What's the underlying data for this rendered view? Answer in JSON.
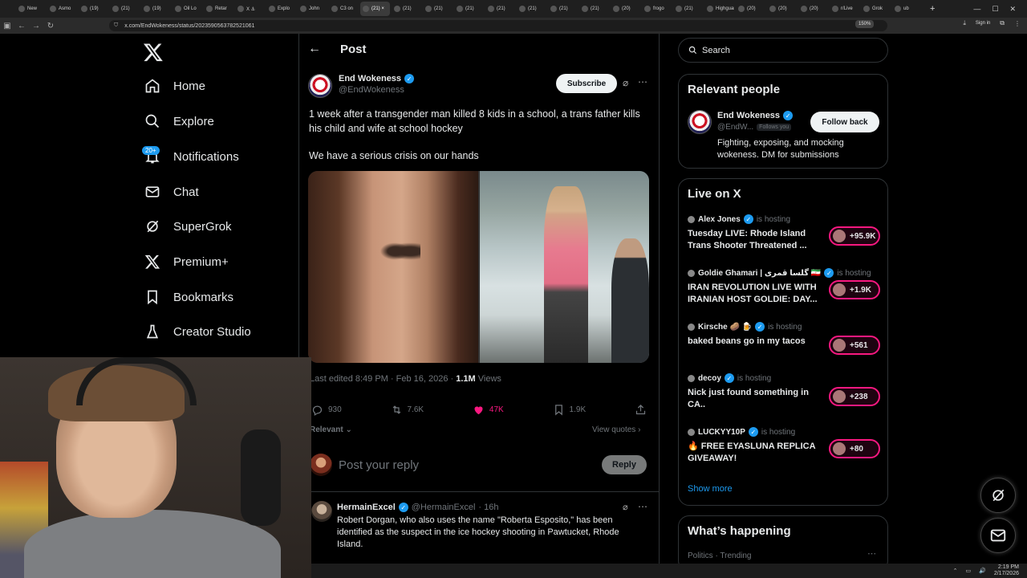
{
  "browser": {
    "tabs": [
      {
        "label": "New"
      },
      {
        "label": "Asmo"
      },
      {
        "label": "(19)"
      },
      {
        "label": "(21)"
      },
      {
        "label": "(19)"
      },
      {
        "label": "Oil Lo"
      },
      {
        "label": "Retar"
      },
      {
        "label": "X ⚓"
      },
      {
        "label": "Explo"
      },
      {
        "label": "John"
      },
      {
        "label": "C3 on"
      },
      {
        "label": "(21) ×",
        "active": true
      },
      {
        "label": "(21)"
      },
      {
        "label": "(21)"
      },
      {
        "label": "(21)"
      },
      {
        "label": "(21)"
      },
      {
        "label": "(21)"
      },
      {
        "label": "(21)"
      },
      {
        "label": "(21)"
      },
      {
        "label": "(20)"
      },
      {
        "label": "frogo"
      },
      {
        "label": "(21)"
      },
      {
        "label": "Highguar"
      },
      {
        "label": "(20)"
      },
      {
        "label": "(20)"
      },
      {
        "label": "(20)"
      },
      {
        "label": "r/Live"
      },
      {
        "label": "Grok"
      },
      {
        "label": "ub"
      }
    ],
    "url": "x.com/EndWokeness/status/2023590563782521061",
    "zoom": "150%",
    "signin": "Sign in"
  },
  "nav": {
    "items": [
      {
        "label": "Home"
      },
      {
        "label": "Explore"
      },
      {
        "label": "Notifications"
      },
      {
        "label": "Chat"
      },
      {
        "label": "SuperGrok"
      },
      {
        "label": "Premium+"
      },
      {
        "label": "Bookmarks"
      },
      {
        "label": "Creator Studio"
      }
    ],
    "notif_badge": "20+"
  },
  "post": {
    "header_title": "Post",
    "author_name": "End Wokeness",
    "author_handle": "@EndWokeness",
    "subscribe_label": "Subscribe",
    "text_line1": "1 week after a transgender man killed 8 kids in a school, a trans father kills his child and wife at school hockey",
    "text_line2": "We have a serious crisis on our hands",
    "edited_prefix": "Last edited 8:49 PM · Feb 16, 2026 · ",
    "views_count": "1.1M",
    "views_label": " Views",
    "stats": {
      "replies": "930",
      "reposts": "7.6K",
      "likes": "47K",
      "bookmarks": "1.9K"
    },
    "relevant_label": "Relevant ⌄",
    "view_quotes_label": "View quotes ›",
    "reply_placeholder": "Post your reply",
    "reply_button": "Reply"
  },
  "comment": {
    "name": "HermainExcel",
    "handle": "@HermainExcel",
    "time": "· 16h",
    "text": "Robert Dorgan, who also uses the name \"Roberta Esposito,\" has been identified as the suspect in the ice hockey shooting in Pawtucket, Rhode Island."
  },
  "sidebar": {
    "search_placeholder": "Search",
    "relevant": {
      "title": "Relevant people",
      "name": "End Wokeness",
      "handle": "@EndW...",
      "follows_you": "Follows you",
      "follow_back": "Follow back",
      "bio": "Fighting, exposing, and mocking wokeness. DM for submissions"
    },
    "live": {
      "title": "Live on X",
      "items": [
        {
          "host": "Alex Jones",
          "status": "is hosting",
          "title": "Tuesday LIVE: Rhode Island Trans Shooter Threatened ...",
          "count": "+95.9K"
        },
        {
          "host": "Goldie Ghamari | گلسا قمری 🇮🇷",
          "status": "is hosting",
          "title": "IRAN REVOLUTION LIVE WITH IRANIAN HOST GOLDIE: DAY...",
          "count": "+1.9K"
        },
        {
          "host": "Kirsche 🥔 🍺",
          "status": "is hosting",
          "title": "baked beans go in my tacos",
          "count": "+561"
        },
        {
          "host": "decoy",
          "status": "is hosting",
          "title": "Nick just found something in CA..",
          "count": "+238"
        },
        {
          "host": "LUCKYY10P",
          "status": "is hosting",
          "title": "🔥 FREE EYASLUNA REPLICA GIVEAWAY!",
          "count": "+80"
        }
      ],
      "show_more": "Show more"
    },
    "happening": {
      "title": "What’s happening",
      "sub": "Politics · Trending"
    }
  },
  "taskbar": {
    "time": "2:19 PM",
    "date": "2/17/2026"
  },
  "colors": {
    "accent": "#1d9bf0",
    "like": "#f91880",
    "bg": "#000000",
    "border": "#2f3336"
  }
}
